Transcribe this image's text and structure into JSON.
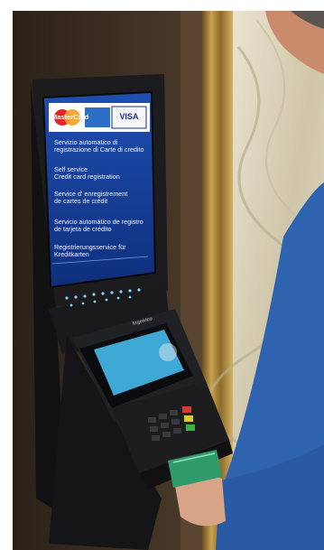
{
  "brands": {
    "mastercard": "MasterCard",
    "visa": "VISA"
  },
  "screen_lines": [
    "Servizio automatico di\nregistrazione di Carte di credito",
    "Self service\nCredit card registration",
    "Service d' enregistrement\nde cartes de crédit",
    "Servicio automático de registro\nde tarjeta de crédito",
    "Registrierungsservice für\nKreditkarten"
  ],
  "terminal_brand": "Ingenico",
  "colors": {
    "screen_bg": "#173f96",
    "marble": "#d9d0b6",
    "gold_frame": "#b08a3c",
    "wall": "#3b2e22",
    "sweater": "#2e63b0"
  }
}
